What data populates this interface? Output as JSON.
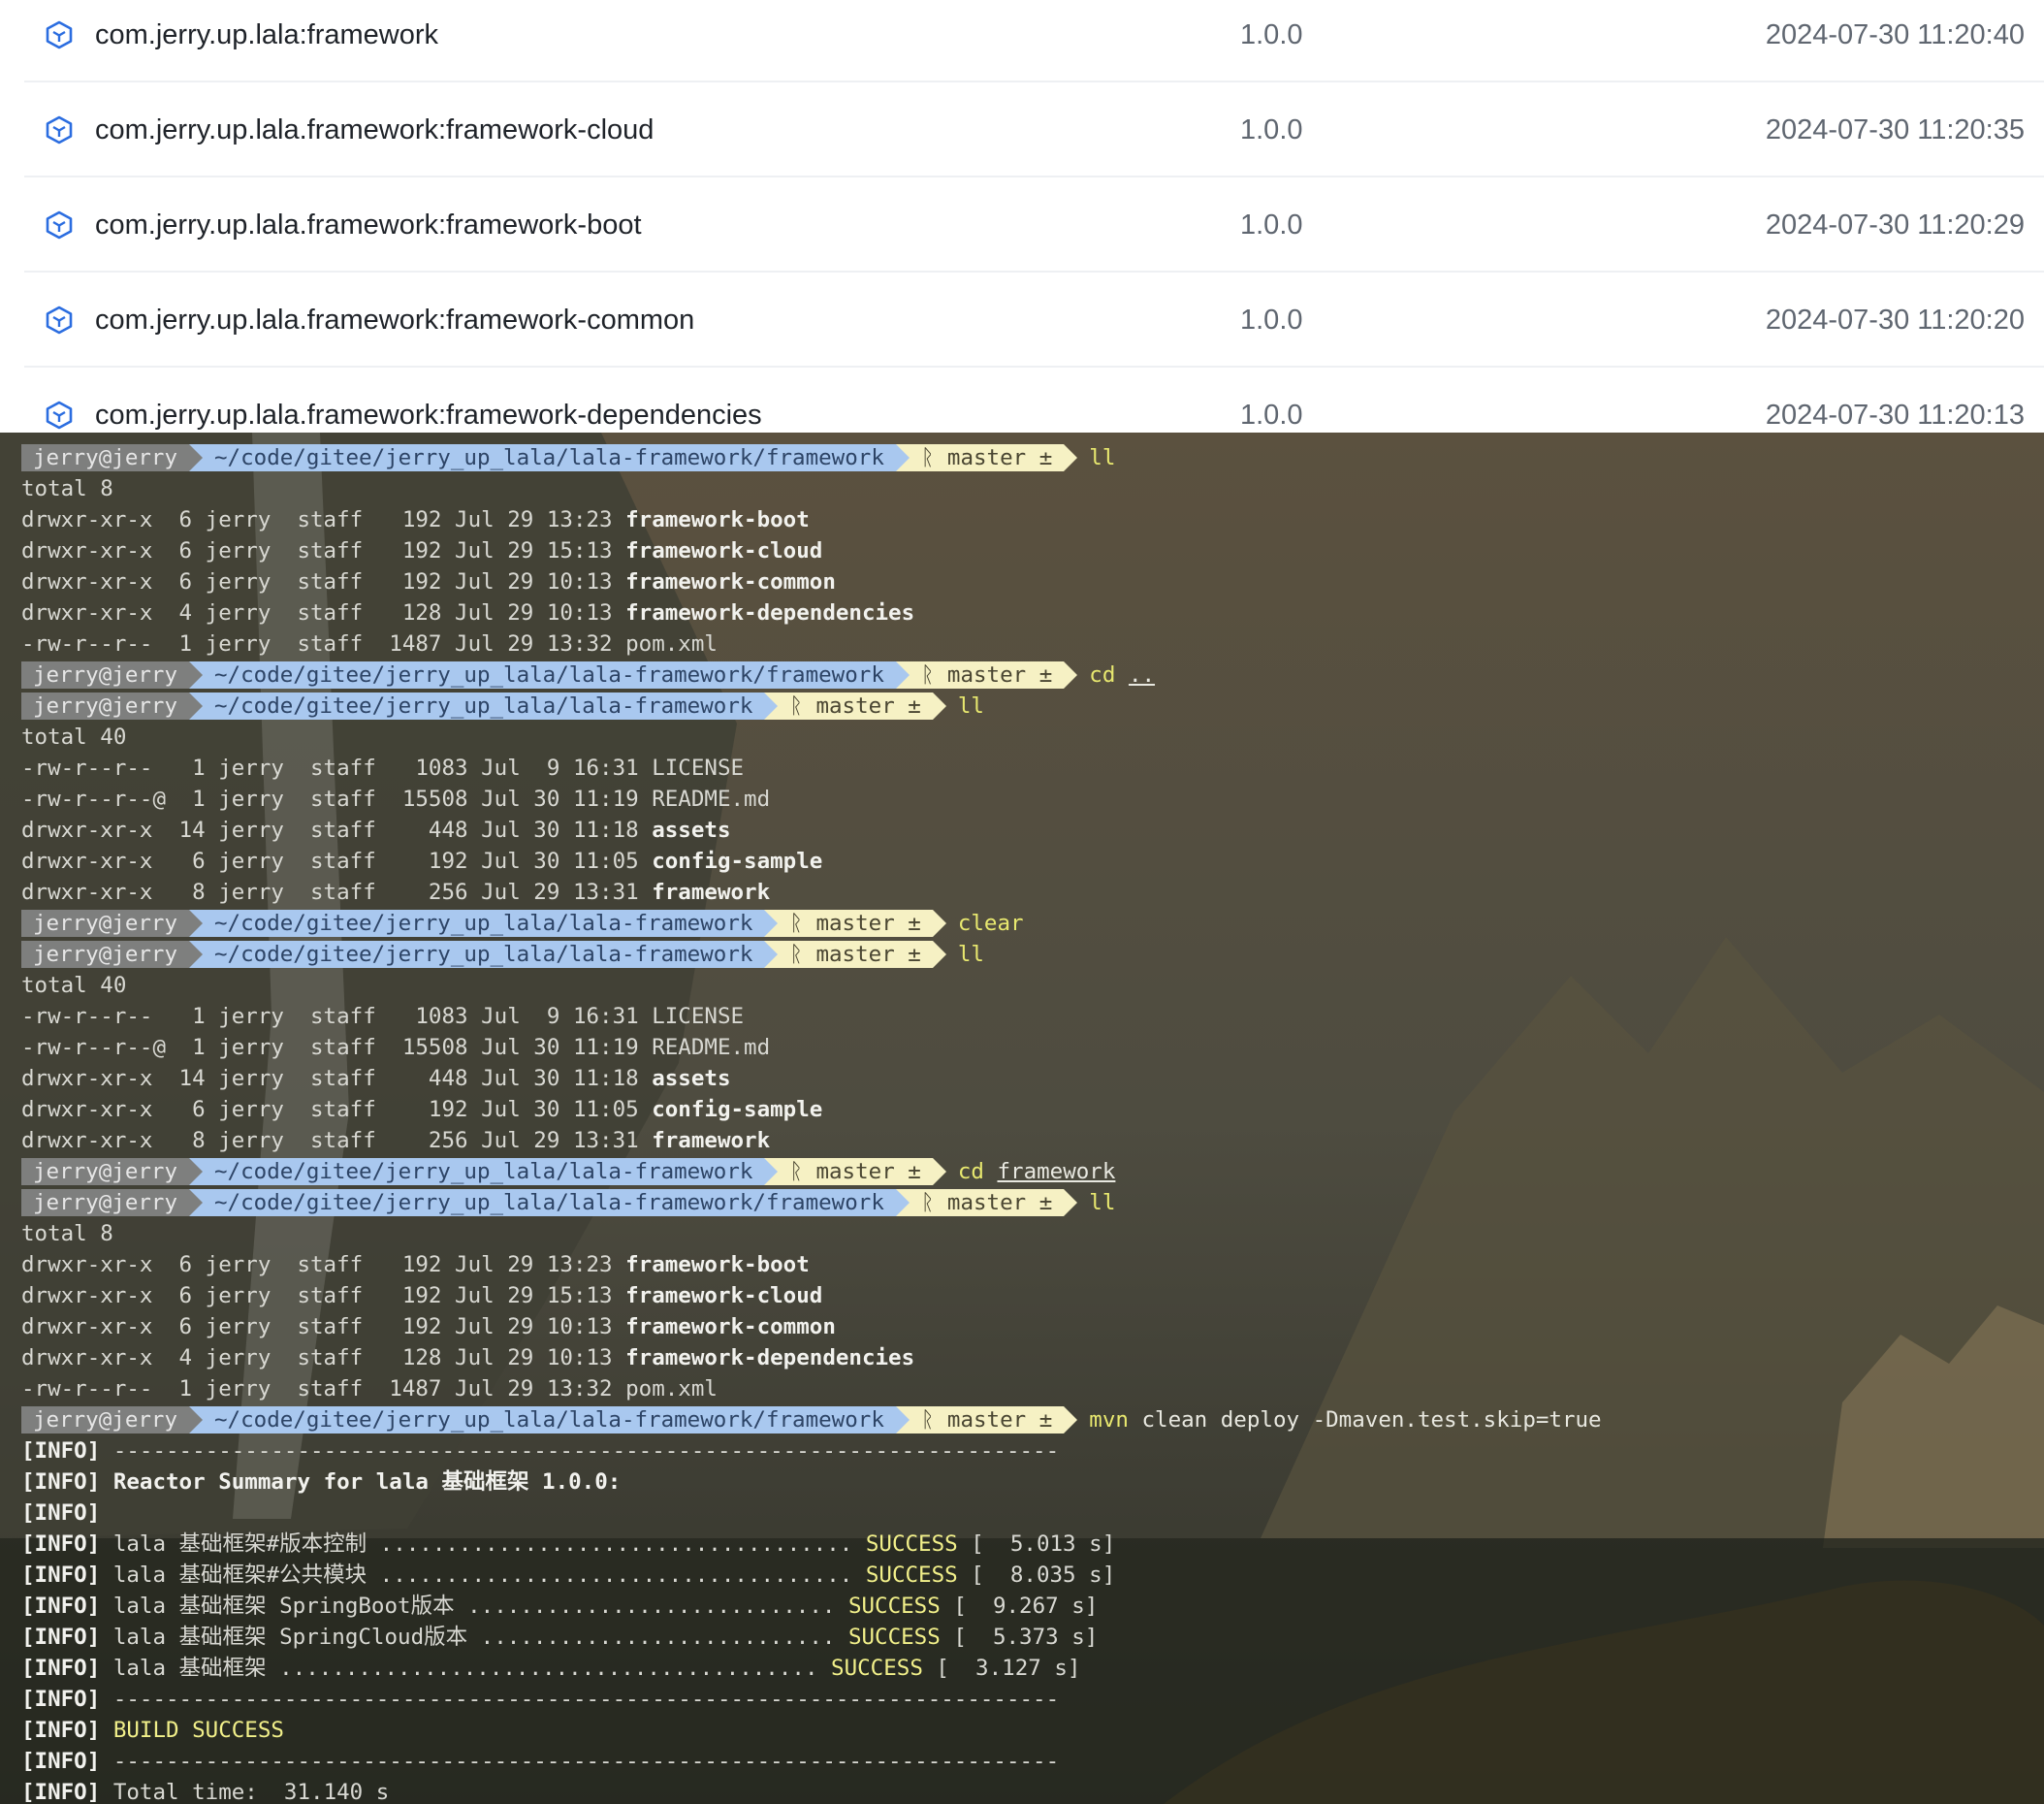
{
  "artifacts": [
    {
      "name": "com.jerry.up.lala:framework",
      "version": "1.0.0",
      "time": "2024-07-30 11:20:40"
    },
    {
      "name": "com.jerry.up.lala.framework:framework-cloud",
      "version": "1.0.0",
      "time": "2024-07-30 11:20:35"
    },
    {
      "name": "com.jerry.up.lala.framework:framework-boot",
      "version": "1.0.0",
      "time": "2024-07-30 11:20:29"
    },
    {
      "name": "com.jerry.up.lala.framework:framework-common",
      "version": "1.0.0",
      "time": "2024-07-30 11:20:20"
    },
    {
      "name": "com.jerry.up.lala.framework:framework-dependencies",
      "version": "1.0.0",
      "time": "2024-07-30 11:20:13"
    }
  ],
  "artifact_icon": "package-icon",
  "colors": {
    "icon": "#2b6de0",
    "prompt_user": "#7e7f7e",
    "prompt_path": "#a9c8ef",
    "prompt_git": "#f6f1c4",
    "command": "#e8e86f"
  },
  "terminal": {
    "lines": [
      {
        "kind": "prompt",
        "user": "jerry@jerry",
        "path": "~/code/gitee/jerry_up_lala/lala-framework/framework",
        "git": "ᚱ master ±",
        "cmd": "ll",
        "arg": ""
      },
      {
        "kind": "text",
        "text": "total 8"
      },
      {
        "kind": "ls",
        "perm": "drwxr-xr-x  6 jerry  staff   192 Jul 29 13:23 ",
        "name": "framework-boot",
        "dir": true
      },
      {
        "kind": "ls",
        "perm": "drwxr-xr-x  6 jerry  staff   192 Jul 29 15:13 ",
        "name": "framework-cloud",
        "dir": true
      },
      {
        "kind": "ls",
        "perm": "drwxr-xr-x  6 jerry  staff   192 Jul 29 10:13 ",
        "name": "framework-common",
        "dir": true
      },
      {
        "kind": "ls",
        "perm": "drwxr-xr-x  4 jerry  staff   128 Jul 29 10:13 ",
        "name": "framework-dependencies",
        "dir": true
      },
      {
        "kind": "ls",
        "perm": "-rw-r--r--  1 jerry  staff  1487 Jul 29 13:32 ",
        "name": "pom.xml",
        "dir": false
      },
      {
        "kind": "prompt",
        "user": "jerry@jerry",
        "path": "~/code/gitee/jerry_up_lala/lala-framework/framework",
        "git": "ᚱ master ±",
        "cmd": "cd",
        "arg": ".."
      },
      {
        "kind": "prompt",
        "user": "jerry@jerry",
        "path": "~/code/gitee/jerry_up_lala/lala-framework",
        "git": "ᚱ master ±",
        "cmd": "ll",
        "arg": ""
      },
      {
        "kind": "text",
        "text": "total 40"
      },
      {
        "kind": "ls",
        "perm": "-rw-r--r--   1 jerry  staff   1083 Jul  9 16:31 ",
        "name": "LICENSE",
        "dir": false
      },
      {
        "kind": "ls",
        "perm": "-rw-r--r--@  1 jerry  staff  15508 Jul 30 11:19 ",
        "name": "README.md",
        "dir": false
      },
      {
        "kind": "ls",
        "perm": "drwxr-xr-x  14 jerry  staff    448 Jul 30 11:18 ",
        "name": "assets",
        "dir": true
      },
      {
        "kind": "ls",
        "perm": "drwxr-xr-x   6 jerry  staff    192 Jul 30 11:05 ",
        "name": "config-sample",
        "dir": true
      },
      {
        "kind": "ls",
        "perm": "drwxr-xr-x   8 jerry  staff    256 Jul 29 13:31 ",
        "name": "framework",
        "dir": true
      },
      {
        "kind": "prompt",
        "user": "jerry@jerry",
        "path": "~/code/gitee/jerry_up_lala/lala-framework",
        "git": "ᚱ master ±",
        "cmd": "clear",
        "arg": ""
      },
      {
        "kind": "prompt",
        "user": "jerry@jerry",
        "path": "~/code/gitee/jerry_up_lala/lala-framework",
        "git": "ᚱ master ±",
        "cmd": "ll",
        "arg": ""
      },
      {
        "kind": "text",
        "text": "total 40"
      },
      {
        "kind": "ls",
        "perm": "-rw-r--r--   1 jerry  staff   1083 Jul  9 16:31 ",
        "name": "LICENSE",
        "dir": false
      },
      {
        "kind": "ls",
        "perm": "-rw-r--r--@  1 jerry  staff  15508 Jul 30 11:19 ",
        "name": "README.md",
        "dir": false
      },
      {
        "kind": "ls",
        "perm": "drwxr-xr-x  14 jerry  staff    448 Jul 30 11:18 ",
        "name": "assets",
        "dir": true
      },
      {
        "kind": "ls",
        "perm": "drwxr-xr-x   6 jerry  staff    192 Jul 30 11:05 ",
        "name": "config-sample",
        "dir": true
      },
      {
        "kind": "ls",
        "perm": "drwxr-xr-x   8 jerry  staff    256 Jul 29 13:31 ",
        "name": "framework",
        "dir": true
      },
      {
        "kind": "prompt",
        "user": "jerry@jerry",
        "path": "~/code/gitee/jerry_up_lala/lala-framework",
        "git": "ᚱ master ±",
        "cmd": "cd",
        "arg": "framework"
      },
      {
        "kind": "prompt",
        "user": "jerry@jerry",
        "path": "~/code/gitee/jerry_up_lala/lala-framework/framework",
        "git": "ᚱ master ±",
        "cmd": "ll",
        "arg": ""
      },
      {
        "kind": "text",
        "text": "total 8"
      },
      {
        "kind": "ls",
        "perm": "drwxr-xr-x  6 jerry  staff   192 Jul 29 13:23 ",
        "name": "framework-boot",
        "dir": true
      },
      {
        "kind": "ls",
        "perm": "drwxr-xr-x  6 jerry  staff   192 Jul 29 15:13 ",
        "name": "framework-cloud",
        "dir": true
      },
      {
        "kind": "ls",
        "perm": "drwxr-xr-x  6 jerry  staff   192 Jul 29 10:13 ",
        "name": "framework-common",
        "dir": true
      },
      {
        "kind": "ls",
        "perm": "drwxr-xr-x  4 jerry  staff   128 Jul 29 10:13 ",
        "name": "framework-dependencies",
        "dir": true
      },
      {
        "kind": "ls",
        "perm": "-rw-r--r--  1 jerry  staff  1487 Jul 29 13:32 ",
        "name": "pom.xml",
        "dir": false
      },
      {
        "kind": "prompt",
        "user": "jerry@jerry",
        "path": "~/code/gitee/jerry_up_lala/lala-framework/framework",
        "git": "ᚱ master ±",
        "cmd": "mvn",
        "arg": "clean deploy -Dmaven.test.skip=true",
        "plain_arg": true
      },
      {
        "kind": "info",
        "pre": "[INFO] ",
        "text": "------------------------------------------------------------------------"
      },
      {
        "kind": "info",
        "pre": "[INFO] ",
        "text": "Reactor Summary for lala 基础框架 1.0.0:",
        "bold": true
      },
      {
        "kind": "info",
        "pre": "[INFO]",
        "text": ""
      },
      {
        "kind": "info",
        "pre": "[INFO] ",
        "text": "lala 基础框架#版本控制 .................................... ",
        "status": "SUCCESS",
        "tail": " [  5.013 s]"
      },
      {
        "kind": "info",
        "pre": "[INFO] ",
        "text": "lala 基础框架#公共模块 .................................... ",
        "status": "SUCCESS",
        "tail": " [  8.035 s]"
      },
      {
        "kind": "info",
        "pre": "[INFO] ",
        "text": "lala 基础框架 SpringBoot版本 ............................ ",
        "status": "SUCCESS",
        "tail": " [  9.267 s]"
      },
      {
        "kind": "info",
        "pre": "[INFO] ",
        "text": "lala 基础框架 SpringCloud版本 ........................... ",
        "status": "SUCCESS",
        "tail": " [  5.373 s]"
      },
      {
        "kind": "info",
        "pre": "[INFO] ",
        "text": "lala 基础框架 ......................................... ",
        "status": "SUCCESS",
        "tail": " [  3.127 s]"
      },
      {
        "kind": "info",
        "pre": "[INFO] ",
        "text": "------------------------------------------------------------------------"
      },
      {
        "kind": "info",
        "pre": "[INFO] ",
        "text": "BUILD SUCCESS",
        "ok": true
      },
      {
        "kind": "info",
        "pre": "[INFO] ",
        "text": "------------------------------------------------------------------------"
      },
      {
        "kind": "info",
        "pre": "[INFO] ",
        "text": "Total time:  31.140 s"
      }
    ]
  }
}
